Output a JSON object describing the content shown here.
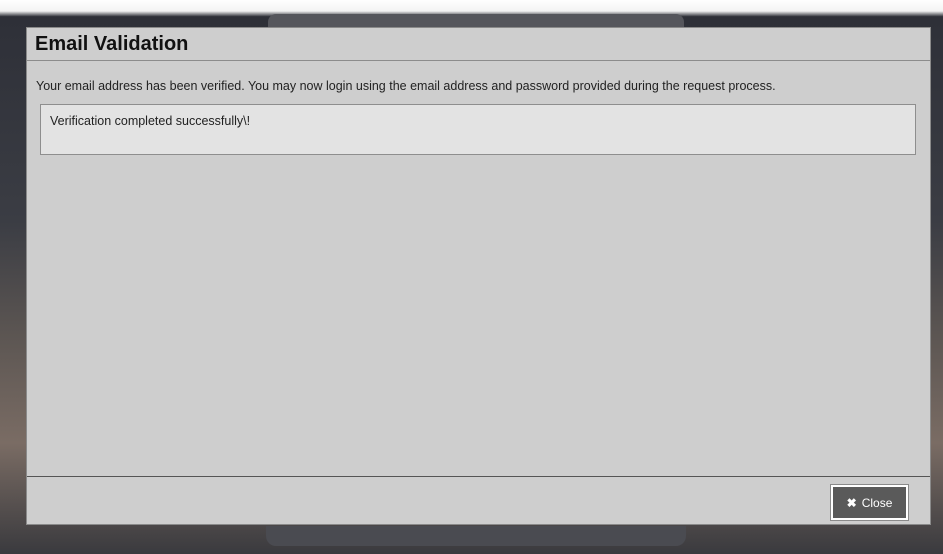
{
  "dialog": {
    "title": "Email Validation",
    "message": "Your email address has been verified. You may now login using the email address and password provided during the request process.",
    "status_text": "Verification completed successfully\\!"
  },
  "footer": {
    "close_label": "Close",
    "close_icon": "close-icon"
  }
}
